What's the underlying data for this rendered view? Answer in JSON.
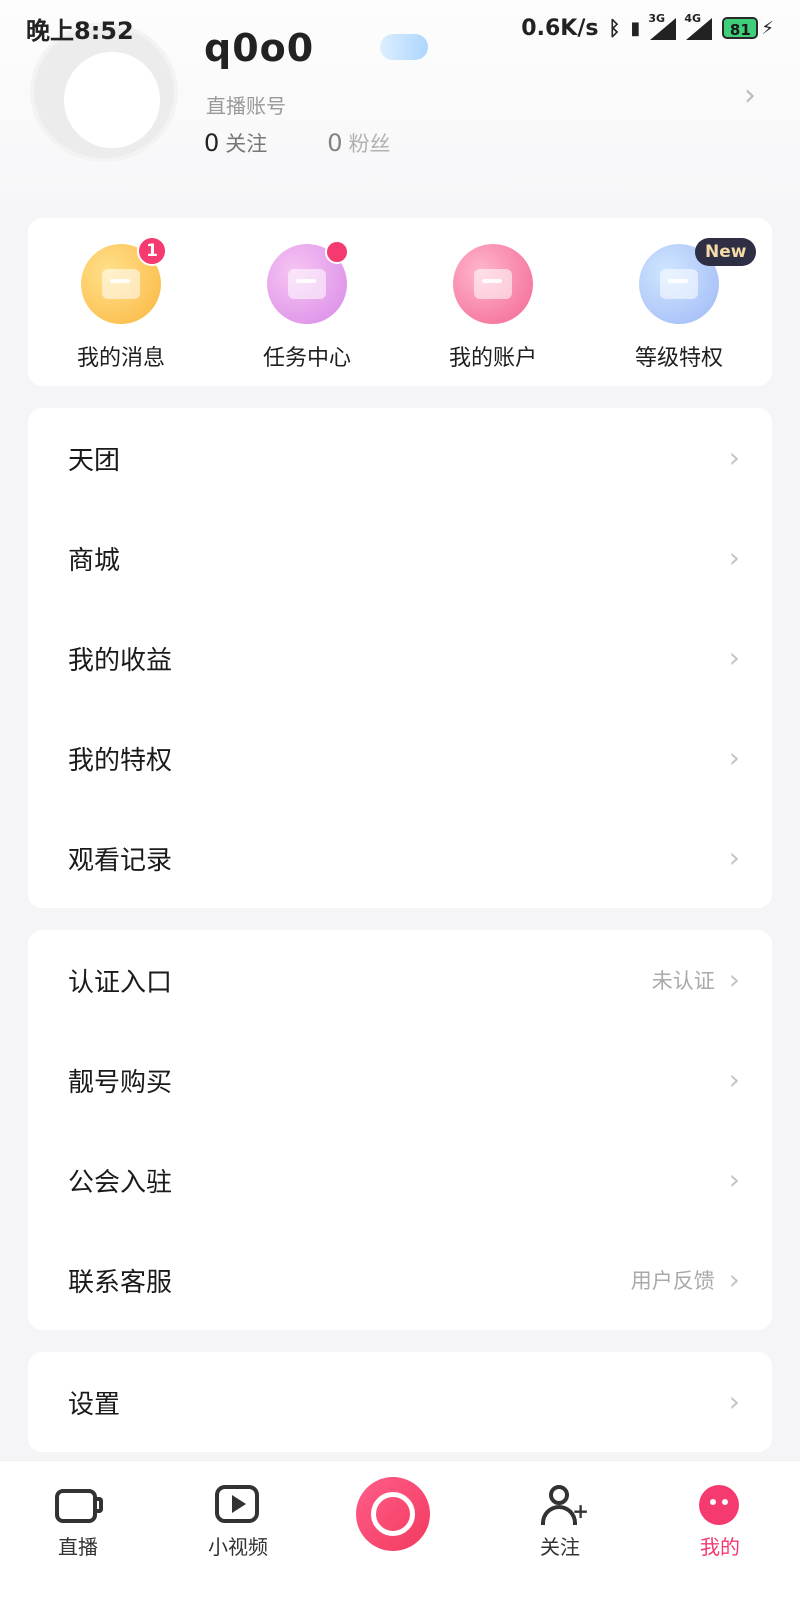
{
  "status_bar": {
    "time": "晚上8:52",
    "net_speed": "0.6K/s",
    "sig1": "3G",
    "sig2": "4G",
    "battery": "81"
  },
  "profile": {
    "username": "q0o0",
    "account_label": "直播账号",
    "following_count": "0",
    "following_label": "关注",
    "fans_count": "0",
    "fans_label": "粉丝"
  },
  "quick_actions": [
    {
      "label": "我的消息",
      "badge": "1",
      "icon": "message-icon"
    },
    {
      "label": "任务中心",
      "badge": "",
      "icon": "calendar-check-icon"
    },
    {
      "label": "我的账户",
      "badge": "",
      "icon": "wallet-folder-icon"
    },
    {
      "label": "等级特权",
      "badge": "New",
      "icon": "crown-icon"
    }
  ],
  "menu_group1": [
    {
      "label": "天团"
    },
    {
      "label": "商城"
    },
    {
      "label": "我的收益"
    },
    {
      "label": "我的特权"
    },
    {
      "label": "观看记录"
    }
  ],
  "menu_group2": [
    {
      "label": "认证入口",
      "hint": "未认证"
    },
    {
      "label": "靓号购买",
      "hint": ""
    },
    {
      "label": "公会入驻",
      "hint": ""
    },
    {
      "label": "联系客服",
      "hint": "用户反馈"
    }
  ],
  "menu_group3": [
    {
      "label": "设置"
    }
  ],
  "bottom_nav": {
    "live": "直播",
    "short_video": "小视频",
    "follow": "关注",
    "me": "我的"
  },
  "colors": {
    "accent": "#f43a6f",
    "background": "#f5f5f7"
  }
}
